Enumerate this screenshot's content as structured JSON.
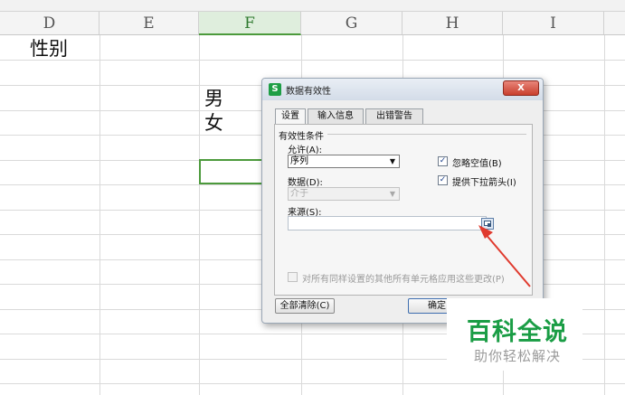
{
  "sheet": {
    "columns": [
      "D",
      "E",
      "F",
      "G",
      "H",
      "I"
    ],
    "active_column": "F",
    "cells": {
      "d2": "性别",
      "f4": "男",
      "f5": "女"
    }
  },
  "dialog": {
    "title": "数据有效性",
    "close_label": "X",
    "tabs": [
      "设置",
      "输入信息",
      "出错警告"
    ],
    "active_tab": "设置",
    "section_title": "有效性条件",
    "allow_label": "允许(A):",
    "allow_value": "序列",
    "data_label": "数据(D):",
    "data_value": "介于",
    "ignore_blank_label": "忽略空值(B)",
    "ignore_blank_checked": true,
    "dropdown_label": "提供下拉箭头(I)",
    "dropdown_checked": true,
    "source_label": "来源(S):",
    "source_value": "",
    "apply_all_label": "对所有同样设置的其他所有单元格应用这些更改(P)",
    "apply_all_checked": false,
    "clear_all_label": "全部清除(C)",
    "ok_label": "确定"
  },
  "watermark": {
    "main": "百科全说",
    "sub": "助你轻松解决"
  },
  "colors": {
    "accent_green": "#4c9a3c",
    "annotation_red": "#e03a2e",
    "watermark_green": "#1a9d45"
  }
}
